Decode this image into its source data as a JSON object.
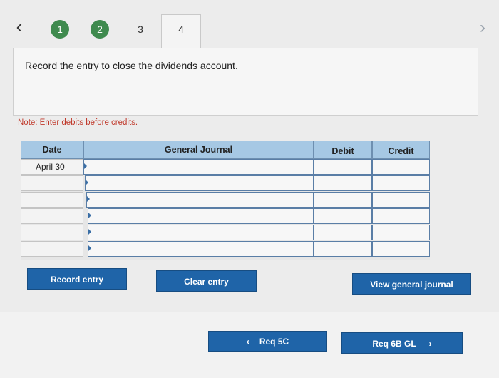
{
  "nav": {
    "prev_glyph": "‹",
    "next_glyph": "›",
    "steps": [
      {
        "label": "1",
        "state": "done"
      },
      {
        "label": "2",
        "state": "done"
      },
      {
        "label": "3",
        "state": "plain"
      },
      {
        "label": "4",
        "state": "active"
      }
    ]
  },
  "instruction": "Record the entry to close the dividends account.",
  "note": "Note: Enter debits before credits.",
  "journal": {
    "headers": {
      "date": "Date",
      "account": "General Journal",
      "debit": "Debit",
      "credit": "Credit"
    },
    "rows": [
      {
        "date": "April 30"
      },
      {
        "date": ""
      },
      {
        "date": ""
      },
      {
        "date": ""
      },
      {
        "date": ""
      },
      {
        "date": ""
      }
    ]
  },
  "buttons": {
    "record": "Record entry",
    "clear": "Clear entry",
    "view": "View general journal"
  },
  "footer": {
    "prev_label": "Req 5C",
    "next_label": "Req 6B GL"
  },
  "colors": {
    "step_done": "#3f8a4e",
    "header_blue": "#a6c8e4",
    "button_blue": "#1f64a8",
    "note_red": "#c0392b"
  }
}
